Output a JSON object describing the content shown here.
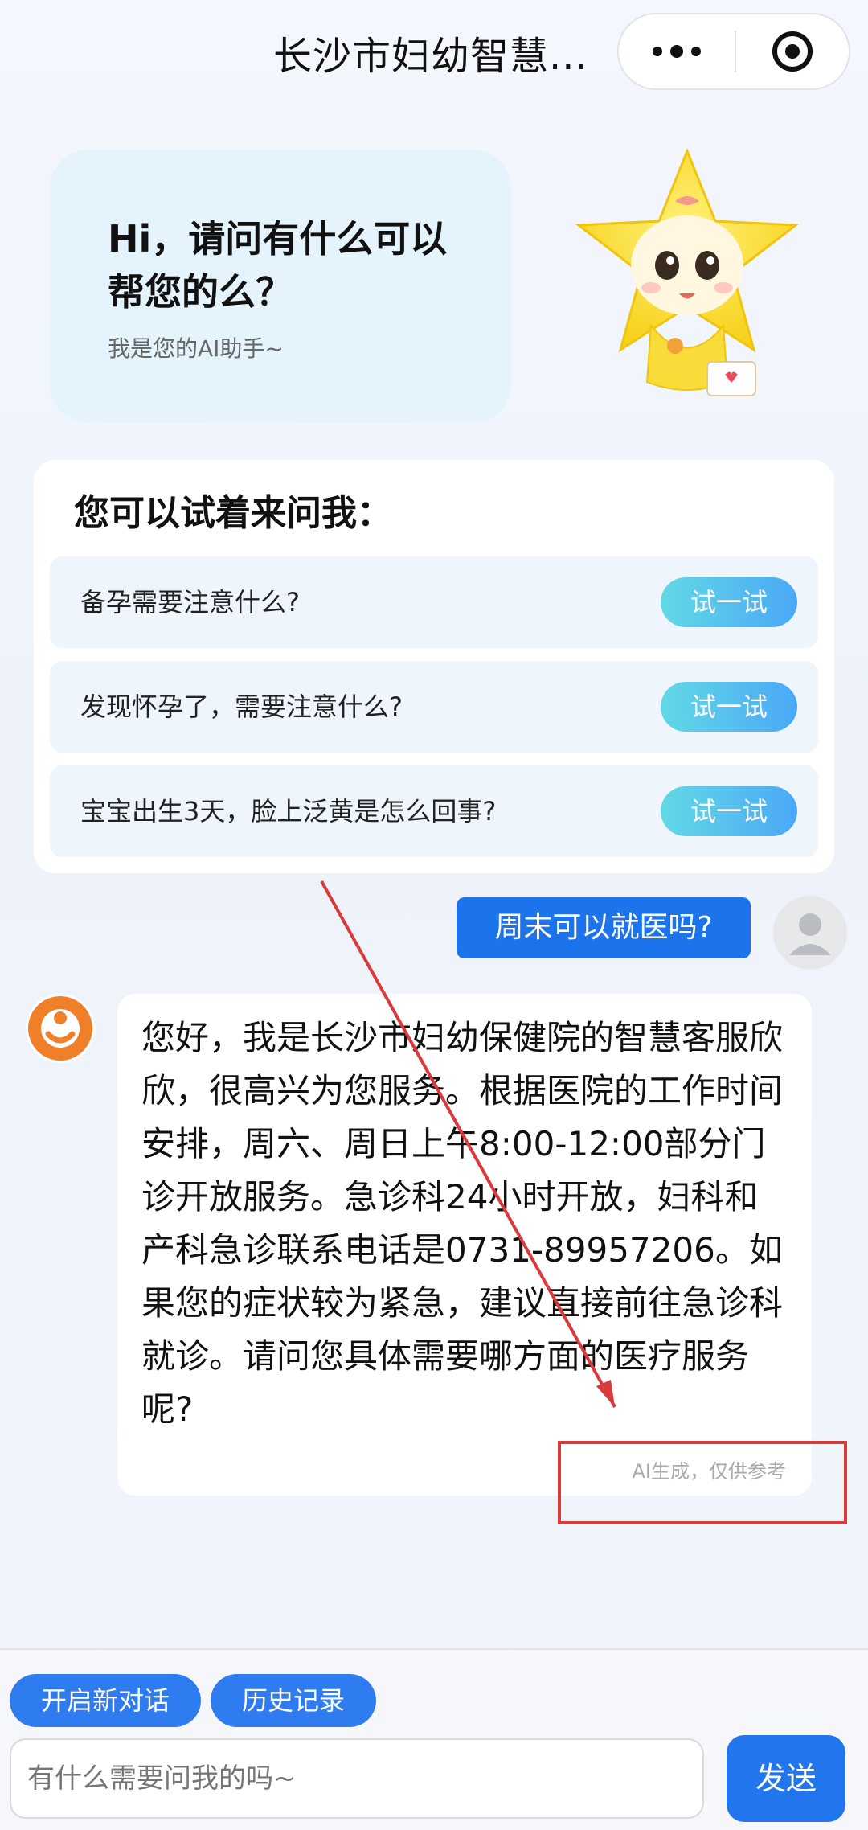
{
  "header": {
    "title": "长沙市妇幼智慧..."
  },
  "greeting": {
    "title": "Hi，请问有什么可以帮您的么？",
    "subtitle": "我是您的AI助手~"
  },
  "suggestions": {
    "title": "您可以试着来问我：",
    "items": [
      {
        "text": "备孕需要注意什么?",
        "button": "试一试"
      },
      {
        "text": "发现怀孕了，需要注意什么?",
        "button": "试一试"
      },
      {
        "text": "宝宝出生3天，脸上泛黄是怎么回事?",
        "button": "试一试"
      }
    ]
  },
  "chat": {
    "user_message": "周末可以就医吗?",
    "bot_message": "您好，我是长沙市妇幼保健院的智慧客服欣欣，很高兴为您服务。根据医院的工作时间安排，周六、周日上午8:00-12:00部分门诊开放服务。急诊科24小时开放，妇科和产科急诊联系电话是0731-89957206。如果您的症状较为紧急，建议直接前往急诊科就诊。请问您具体需要哪方面的医疗服务呢?",
    "ai_note": "AI生成，仅供参考"
  },
  "bottom": {
    "new_chat": "开启新对话",
    "history": "历史记录",
    "input_placeholder": "有什么需要问我的吗~",
    "send": "发送"
  },
  "colors": {
    "primary": "#1c74ec",
    "annotation": "#d93a3a"
  }
}
